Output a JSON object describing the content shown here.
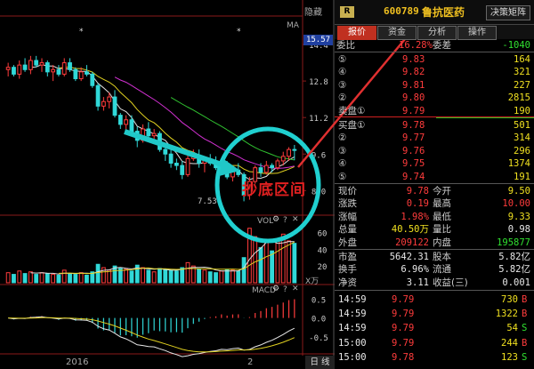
{
  "chart_header": {
    "hide_label": "隐藏",
    "ma_label": "MA",
    "price_box": "15.57",
    "low_marker": "7.53",
    "vol_label": "VOL",
    "vol_unit": "X万",
    "macd_label": "MACD",
    "marker_star": "*"
  },
  "price_axis": [
    "14.4",
    "12.8",
    "11.2",
    "9.6",
    "8.0"
  ],
  "vol_axis": [
    "60",
    "40",
    "20"
  ],
  "macd_axis": [
    "0.5",
    "0.0",
    "-0.5"
  ],
  "x_axis": {
    "label_1": "2016",
    "label_2": "2",
    "day_tab": "日 线"
  },
  "annotation": "抄底区间",
  "quote": {
    "badge": "R",
    "code": "600789",
    "name": "鲁抗医药",
    "decision_button": "决策矩阵",
    "tabs": [
      "报价",
      "资金",
      "分析",
      "操作"
    ],
    "weibi": {
      "label": "委比",
      "value": "16.28%",
      "label2": "委差",
      "value2": "-1040"
    },
    "asks": [
      {
        "lvl": "⑤",
        "price": "9.83",
        "vol": "164"
      },
      {
        "lvl": "④",
        "price": "9.82",
        "vol": "321"
      },
      {
        "lvl": "③",
        "price": "9.81",
        "vol": "227"
      },
      {
        "lvl": "②",
        "price": "9.80",
        "vol": "2815"
      },
      {
        "lvl": "卖盘①",
        "price": "9.79",
        "vol": "190"
      }
    ],
    "bids": [
      {
        "lvl": "买盘①",
        "price": "9.78",
        "vol": "501"
      },
      {
        "lvl": "②",
        "price": "9.77",
        "vol": "314"
      },
      {
        "lvl": "③",
        "price": "9.76",
        "vol": "296"
      },
      {
        "lvl": "④",
        "price": "9.75",
        "vol": "1374"
      },
      {
        "lvl": "⑤",
        "price": "9.74",
        "vol": "191"
      }
    ],
    "stats": [
      {
        "l1": "现价",
        "v1": "9.78",
        "c1": "red",
        "l2": "今开",
        "v2": "9.50",
        "c2": "yel"
      },
      {
        "l1": "涨跌",
        "v1": "0.19",
        "c1": "red",
        "l2": "最高",
        "v2": "10.00",
        "c2": "red"
      },
      {
        "l1": "涨幅",
        "v1": "1.98%",
        "c1": "red",
        "l2": "最低",
        "v2": "9.33",
        "c2": "yel"
      },
      {
        "l1": "总量",
        "v1": "40.50万",
        "c1": "yel",
        "l2": "量比",
        "v2": "0.98",
        "c2": "wht"
      },
      {
        "l1": "外盘",
        "v1": "209122",
        "c1": "red",
        "l2": "内盘",
        "v2": "195877",
        "c2": "grn"
      }
    ],
    "fund": [
      {
        "l1": "市盈",
        "v1": "5642.31",
        "l2": "股本",
        "v2": "5.82亿"
      },
      {
        "l1": "换手",
        "v1": "6.96%",
        "l2": "流通",
        "v2": "5.82亿"
      },
      {
        "l1": "净资",
        "v1": "3.11",
        "l2": "收益(三)",
        "v2": "0.001"
      }
    ],
    "ticks": [
      {
        "time": "14:59",
        "price": "9.79",
        "vol": "730",
        "side": "B",
        "c": "red"
      },
      {
        "time": "14:59",
        "price": "9.79",
        "vol": "1322",
        "side": "B",
        "c": "red"
      },
      {
        "time": "14:59",
        "price": "9.79",
        "vol": "54",
        "side": "S",
        "c": "grn"
      },
      {
        "time": "15:00",
        "price": "9.79",
        "vol": "244",
        "side": "B",
        "c": "red"
      },
      {
        "time": "15:00",
        "price": "9.78",
        "vol": "123",
        "side": "S",
        "c": "grn"
      }
    ]
  },
  "colors": {
    "up": "#ff3c3c",
    "down": "#30d8d8",
    "ma5": "#e0e0e0",
    "ma10": "#e0d020",
    "ma20": "#d030d0",
    "ma60": "#30c030",
    "circle": "#20d0d0",
    "arrow": "#e03030"
  },
  "chart_data": {
    "type": "candlestick",
    "candles": [
      [
        13.3,
        13.6,
        13.0,
        13.4
      ],
      [
        13.4,
        13.5,
        13.0,
        13.1
      ],
      [
        13.1,
        13.7,
        12.9,
        13.5
      ],
      [
        13.5,
        13.8,
        13.2,
        13.3
      ],
      [
        13.3,
        13.9,
        13.1,
        13.7
      ],
      [
        13.7,
        13.9,
        13.4,
        13.5
      ],
      [
        13.5,
        13.8,
        13.2,
        13.6
      ],
      [
        13.6,
        13.7,
        13.0,
        13.2
      ],
      [
        13.2,
        13.5,
        12.8,
        13.3
      ],
      [
        13.3,
        13.5,
        13.0,
        13.1
      ],
      [
        13.1,
        13.8,
        13.0,
        13.6
      ],
      [
        13.6,
        13.8,
        13.2,
        13.3
      ],
      [
        13.3,
        13.4,
        12.8,
        12.9
      ],
      [
        12.9,
        13.4,
        12.8,
        13.2
      ],
      [
        13.2,
        13.5,
        13.0,
        13.1
      ],
      [
        13.1,
        13.2,
        12.5,
        12.6
      ],
      [
        12.6,
        12.7,
        11.5,
        11.7
      ],
      [
        11.7,
        12.1,
        11.5,
        11.9
      ],
      [
        11.9,
        12.3,
        11.6,
        12.1
      ],
      [
        12.1,
        12.4,
        11.2,
        11.3
      ],
      [
        11.3,
        11.4,
        10.7,
        10.9
      ],
      [
        10.9,
        11.3,
        10.6,
        11.1
      ],
      [
        11.1,
        11.3,
        10.5,
        10.6
      ],
      [
        10.6,
        10.8,
        9.9,
        10.2
      ],
      [
        10.2,
        10.9,
        10.1,
        10.7
      ],
      [
        10.7,
        11.0,
        10.3,
        10.4
      ],
      [
        10.4,
        10.7,
        10.2,
        10.5
      ],
      [
        10.5,
        10.6,
        9.7,
        9.8
      ],
      [
        9.8,
        10.0,
        9.3,
        9.6
      ],
      [
        9.6,
        9.9,
        9.0,
        9.2
      ],
      [
        9.2,
        9.4,
        8.9,
        9.1
      ],
      [
        9.1,
        9.3,
        8.5,
        8.7
      ],
      [
        8.7,
        9.6,
        8.6,
        9.4
      ],
      [
        9.4,
        9.8,
        9.3,
        9.5
      ],
      [
        9.5,
        9.8,
        9.0,
        9.2
      ],
      [
        9.2,
        9.4,
        8.8,
        9.3
      ],
      [
        9.3,
        9.6,
        9.1,
        9.2
      ],
      [
        9.2,
        9.5,
        8.9,
        9.0
      ],
      [
        9.0,
        9.3,
        8.7,
        9.2
      ],
      [
        9.2,
        9.3,
        8.5,
        8.6
      ],
      [
        8.6,
        9.0,
        8.4,
        8.9
      ],
      [
        8.9,
        9.2,
        8.6,
        8.7
      ],
      [
        8.7,
        8.8,
        7.53,
        7.8
      ],
      [
        7.8,
        8.6,
        7.6,
        8.4
      ],
      [
        8.4,
        9.1,
        8.3,
        9.0
      ],
      [
        9.0,
        9.2,
        8.6,
        8.8
      ],
      [
        8.8,
        9.3,
        8.7,
        9.1
      ],
      [
        9.1,
        9.2,
        8.8,
        9.0
      ],
      [
        9.0,
        9.4,
        8.9,
        9.3
      ],
      [
        9.3,
        9.7,
        9.1,
        9.5
      ],
      [
        9.5,
        9.9,
        9.3,
        9.8
      ],
      [
        9.8,
        10.0,
        9.33,
        9.78
      ]
    ],
    "volumes": [
      12,
      10,
      14,
      11,
      13,
      10,
      12,
      11,
      10,
      9,
      15,
      11,
      10,
      12,
      9,
      13,
      22,
      18,
      15,
      20,
      17,
      16,
      14,
      21,
      18,
      15,
      13,
      17,
      16,
      15,
      14,
      18,
      24,
      20,
      16,
      15,
      13,
      12,
      14,
      16,
      15,
      14,
      30,
      65,
      55,
      42,
      48,
      38,
      52,
      58,
      50,
      47
    ],
    "price_range": [
      7.0,
      15.57
    ],
    "vol_range": [
      0,
      70
    ],
    "macd_range": [
      -0.9,
      0.6
    ]
  }
}
